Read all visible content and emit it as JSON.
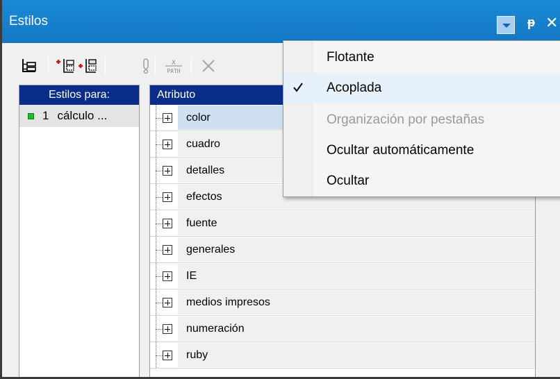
{
  "window": {
    "title": "Estilos",
    "controls": {
      "dropdown_icon": "chevron-down-icon",
      "pin_icon": "pin-icon",
      "pin_glyph": "ᵽ",
      "close_glyph": "✕"
    }
  },
  "toolbar": {
    "buttons": [
      {
        "icon": "tree-view-icon",
        "enabled": true
      },
      {
        "icon": "add-style-icon",
        "enabled": true
      },
      {
        "icon": "insert-style-icon",
        "enabled": true
      },
      {
        "icon": "important-icon",
        "enabled": false
      },
      {
        "icon": "xpath-icon",
        "label": "X PATH",
        "enabled": false
      },
      {
        "icon": "delete-icon",
        "enabled": false
      }
    ]
  },
  "left_panel": {
    "header": "Estilos para:",
    "rows": [
      {
        "number": "1",
        "label": "cálculo ...",
        "dot_color": "#24b830"
      }
    ]
  },
  "right_panel": {
    "header": "Atributo",
    "attributes": [
      {
        "label": "color",
        "selected": true
      },
      {
        "label": "cuadro"
      },
      {
        "label": "detalles"
      },
      {
        "label": "efectos"
      },
      {
        "label": "fuente"
      },
      {
        "label": "generales"
      },
      {
        "label": "IE"
      },
      {
        "label": "medios impresos"
      },
      {
        "label": "numeración"
      },
      {
        "label": "ruby"
      }
    ]
  },
  "context_menu": {
    "items": [
      {
        "label": "Flotante",
        "checked": false,
        "disabled": false
      },
      {
        "label": "Acoplada",
        "checked": true,
        "disabled": false
      },
      {
        "label": "Organización por pestañas",
        "checked": false,
        "disabled": true
      },
      {
        "label": "Ocultar automáticamente",
        "checked": false,
        "disabled": false
      },
      {
        "label": "Ocultar",
        "checked": false,
        "disabled": false
      }
    ]
  },
  "colors": {
    "title_bar": "#1577c4",
    "header_bg": "#0a2d8a",
    "selected_row": "#cfe0f1",
    "menu_checked_bg": "#e6f1fc"
  }
}
